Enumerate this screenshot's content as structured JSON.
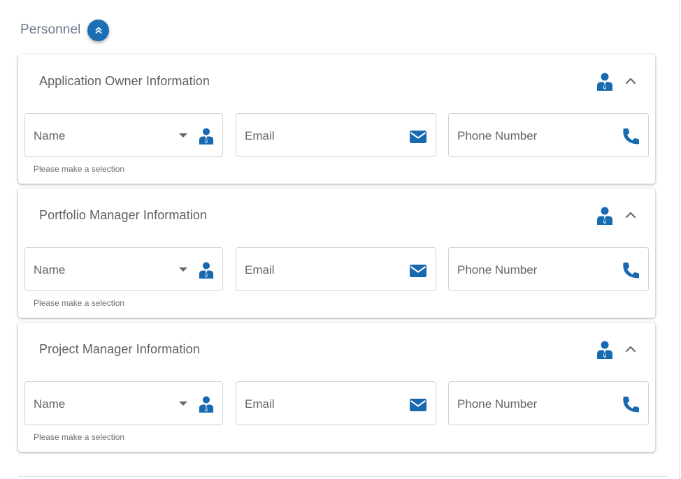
{
  "section": {
    "title": "Personnel",
    "collapse_icon": "double-chevron-up-icon"
  },
  "colors": {
    "accent": "#1a6fb5",
    "icon_blue": "#1769b0",
    "section_title": "#6b7a90"
  },
  "cards": [
    {
      "title": "Application Owner Information",
      "header_icon": "person-icon",
      "toggle_icon": "chevron-up-icon",
      "fields": {
        "name_placeholder": "Name",
        "email_placeholder": "Email",
        "phone_placeholder": "Phone Number"
      },
      "helper_text": "Please make a selection"
    },
    {
      "title": "Portfolio Manager Information",
      "header_icon": "person-icon",
      "toggle_icon": "chevron-up-icon",
      "fields": {
        "name_placeholder": "Name",
        "email_placeholder": "Email",
        "phone_placeholder": "Phone Number"
      },
      "helper_text": "Please make a selection"
    },
    {
      "title": "Project Manager Information",
      "header_icon": "person-icon",
      "toggle_icon": "chevron-up-icon",
      "fields": {
        "name_placeholder": "Name",
        "email_placeholder": "Email",
        "phone_placeholder": "Phone Number"
      },
      "helper_text": "Please make a selection"
    }
  ]
}
